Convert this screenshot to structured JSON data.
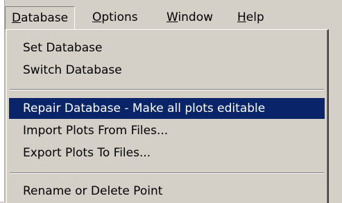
{
  "menubar": {
    "items": [
      {
        "label": "Database"
      },
      {
        "label": "Options"
      },
      {
        "label": "Window"
      },
      {
        "label": "Help"
      }
    ]
  },
  "dropdown": {
    "open_menu": "Database",
    "groups": [
      [
        {
          "label": "Set Database"
        },
        {
          "label": "Switch Database"
        }
      ],
      [
        {
          "label": "Repair Database - Make all plots editable",
          "highlighted": true
        },
        {
          "label": "Import Plots From Files..."
        },
        {
          "label": "Export Plots To Files..."
        }
      ],
      [
        {
          "label": "Rename or Delete Point"
        }
      ]
    ]
  },
  "colors": {
    "highlight_bg": "#0a246a",
    "highlight_text": "#ffffff",
    "face": "#d4d0c8"
  }
}
